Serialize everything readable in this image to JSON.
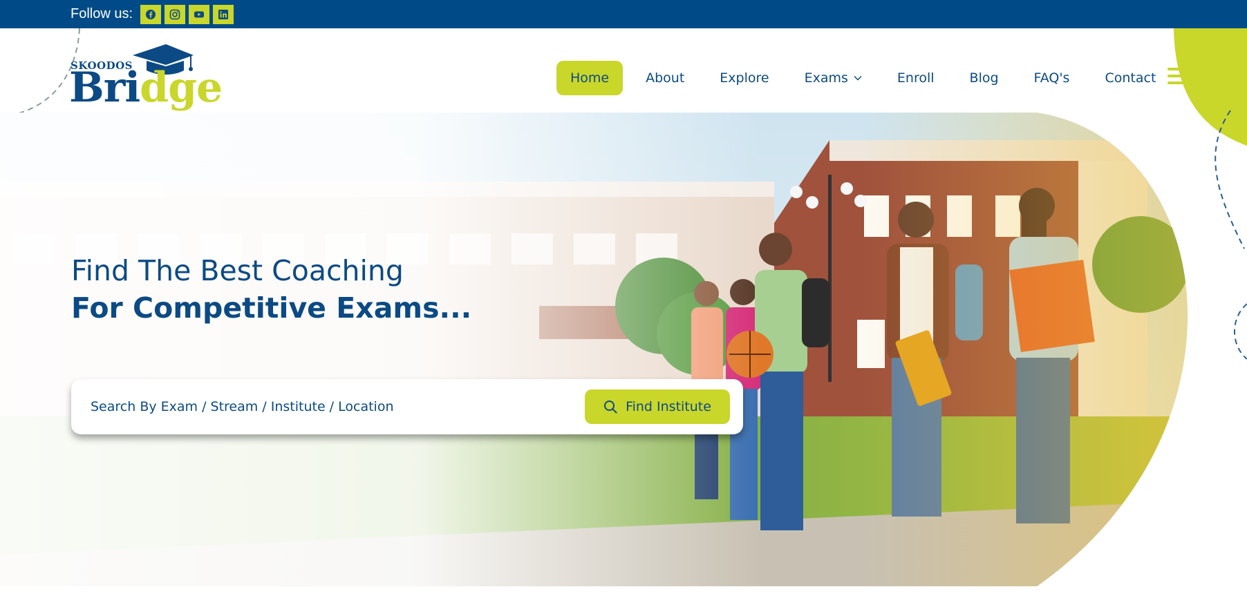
{
  "topbar": {
    "follow_label": "Follow us:",
    "social": [
      "facebook-icon",
      "instagram-icon",
      "youtube-icon",
      "linkedin-icon"
    ]
  },
  "logo": {
    "brand_small": "SKOODOS",
    "brand_main_before": "Bri",
    "brand_main_accent": "dge"
  },
  "nav": {
    "items": [
      {
        "label": "Home",
        "active": true
      },
      {
        "label": "About"
      },
      {
        "label": "Explore"
      },
      {
        "label": "Exams",
        "has_dropdown": true
      },
      {
        "label": "Enroll"
      },
      {
        "label": "Blog"
      },
      {
        "label": "FAQ's"
      },
      {
        "label": "Contact"
      }
    ],
    "menu_icon": "hamburger-icon"
  },
  "hero": {
    "headline_line1": "Find The Best Coaching",
    "headline_line2_prefix": "For ",
    "headline_line2_bold": "Competitive Exams...",
    "search_placeholder": "Search By Exam / Stream / Institute / Location",
    "search_button_label": "Find Institute",
    "search_icon": "search-icon"
  },
  "colors": {
    "primary": "#004b87",
    "accent": "#c9d62a",
    "text": "#0b4a84"
  }
}
